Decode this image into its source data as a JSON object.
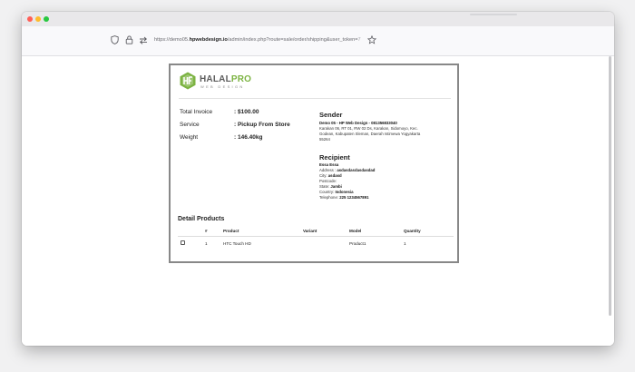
{
  "browser": {
    "url_prefix": "https://demo05.",
    "url_domain": "hpwebdesign.io",
    "url_path": "/admin/index.php?route=sale/order/shipping&user_token=",
    "url_fade": "7",
    "icons": [
      "shield-icon",
      "lock-icon",
      "connection-icon",
      "star-icon"
    ]
  },
  "logo": {
    "name_part1": "HALAL",
    "name_part2": "PRO",
    "subtitle": "WEB DESIGN",
    "colors": {
      "green": "#7cb342",
      "gray": "#5c5c5c"
    }
  },
  "invoice": {
    "rows": [
      {
        "label": "Total Invoice",
        "value": ": $100.00"
      },
      {
        "label": "Service",
        "value": ": Pickup From Store"
      },
      {
        "label": "Weight",
        "value": ": 146.40kg"
      }
    ]
  },
  "sender": {
    "title": "Sender",
    "name": "Demo 05 - HP Web Design - 081356833040",
    "address_lines": [
      "Karakan 06, RT 01, RW 02 Ds, Karakan, Sidomoyo, Kec.",
      "Godean, Kabupaten Sleman, Daerah Istimewa Yogyakarta",
      "55264"
    ]
  },
  "recipient": {
    "title": "Recipient",
    "name": "Essa Essa",
    "address_label": "Address : ",
    "address_value": "asdasdasdasdasdad",
    "city_label": "City: ",
    "city_value": "asdasd",
    "postcode_label": "Postcode:",
    "state_label": "State: ",
    "state_value": "Jambi",
    "country_label": "Country: ",
    "country_value": "Indonesia",
    "telephone_label": "Telephone: ",
    "telephone_value": "225 1234567891"
  },
  "products": {
    "title": "Detail Products",
    "columns": [
      "#",
      "Product",
      "Variant",
      "Model",
      "Quantity"
    ],
    "rows": [
      {
        "num": "1",
        "product": "HTC Touch HD",
        "variant": "",
        "model": "Product1",
        "quantity": "1",
        "checked": false
      }
    ]
  }
}
